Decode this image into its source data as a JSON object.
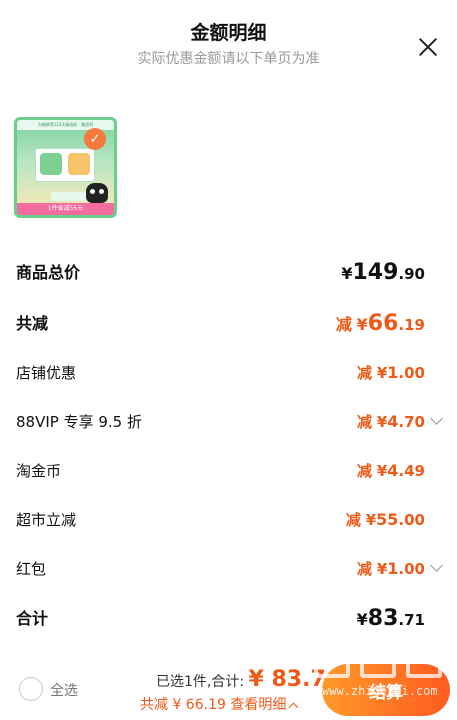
{
  "header": {
    "title": "金额明细",
    "subtitle": "实际优惠金额请以下单页为准"
  },
  "product": {
    "banner_text": "大箱装等122天精选奶 · 雅思科",
    "bottom_text": "1件省减55元"
  },
  "rows": [
    {
      "id": "goods-total",
      "label": "商品总价",
      "currency": "¥",
      "int": "149",
      "dec": ".90",
      "prefix": "",
      "style": "total"
    },
    {
      "id": "total-discount",
      "label": "共减",
      "currency": "¥",
      "int": "66",
      "dec": ".19",
      "prefix": "减",
      "style": "discount-big"
    },
    {
      "id": "shop-discount",
      "label": "店铺优惠",
      "currency": "¥",
      "int": "1",
      "dec": ".00",
      "prefix": "减",
      "style": "discount",
      "chevron": false
    },
    {
      "id": "vip-discount",
      "label": "88VIP 专享 9.5 折",
      "currency": "¥",
      "int": "4",
      "dec": ".70",
      "prefix": "减",
      "style": "discount",
      "chevron": true
    },
    {
      "id": "taojinbi",
      "label": "淘金币",
      "currency": "¥",
      "int": "4",
      "dec": ".49",
      "prefix": "减",
      "style": "discount",
      "chevron": false
    },
    {
      "id": "supermarket",
      "label": "超市立减",
      "currency": "¥",
      "int": "55",
      "dec": ".00",
      "prefix": "减",
      "style": "discount",
      "chevron": false
    },
    {
      "id": "red-packet",
      "label": "红包",
      "currency": "¥",
      "int": "1",
      "dec": ".00",
      "prefix": "减",
      "style": "discount",
      "chevron": true
    },
    {
      "id": "grand-total",
      "label": "合计",
      "currency": "¥",
      "int": "83",
      "dec": ".71",
      "prefix": "",
      "style": "total"
    }
  ],
  "footer": {
    "select_all": "全选",
    "selected_text": "已选1件,合计: ",
    "total_amount": "¥ 83.7",
    "discount_text": "共减 ¥ 66.19",
    "view_detail": "查看明细",
    "checkout_label": "结算"
  },
  "watermark": "www.zhidezhi.com",
  "colors": {
    "accent": "#f05a18",
    "checkout_start": "#ff9a2a",
    "checkout_end": "#ff5a1f"
  }
}
